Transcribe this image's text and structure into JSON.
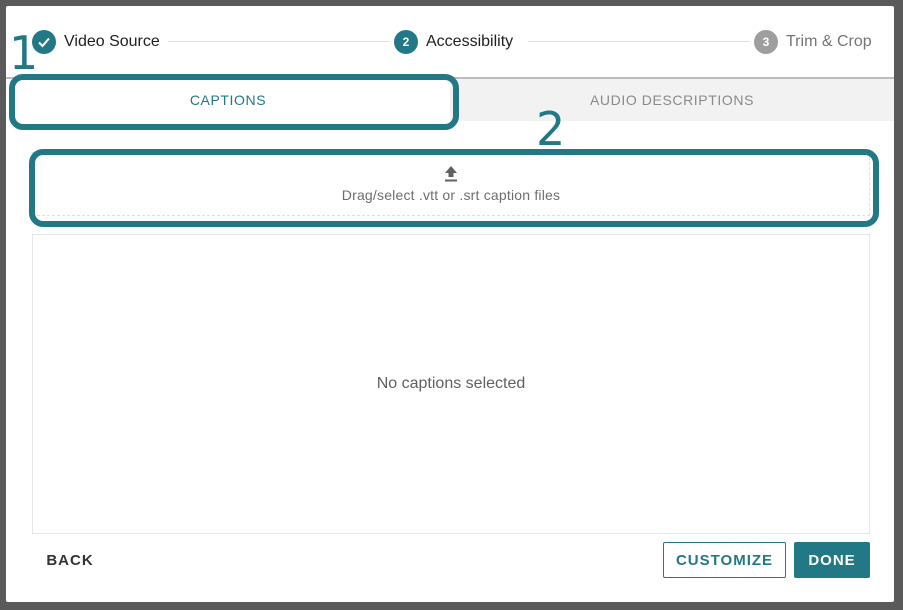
{
  "stepper": {
    "steps": [
      {
        "label": "Video Source",
        "number": "",
        "state": "done"
      },
      {
        "label": "Accessibility",
        "number": "2",
        "state": "active"
      },
      {
        "label": "Trim & Crop",
        "number": "3",
        "state": "pending"
      }
    ]
  },
  "tabs": [
    {
      "label": "CAPTIONS",
      "active": true
    },
    {
      "label": "AUDIO DESCRIPTIONS",
      "active": false
    }
  ],
  "dropzone": {
    "icon": "upload-icon",
    "hint": "Drag/select .vtt or .srt caption files"
  },
  "caption_list": {
    "empty_text": "No captions selected"
  },
  "footer": {
    "back_label": "BACK",
    "customize_label": "CUSTOMIZE",
    "done_label": "DONE"
  },
  "annotations": {
    "marker_1": "1",
    "marker_2": "2"
  },
  "colors": {
    "accent": "#237885",
    "pending": "#9e9e9e",
    "backdrop": "#5a5a5a"
  }
}
